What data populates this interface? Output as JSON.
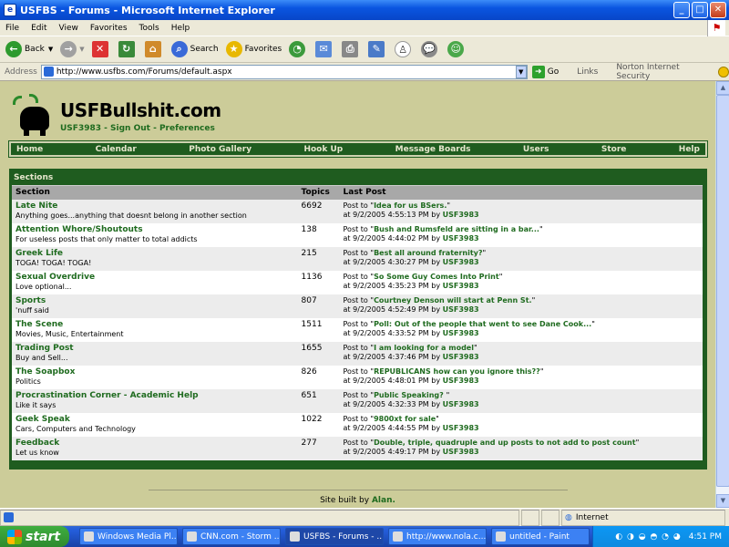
{
  "window": {
    "title": "USFBS - Forums - Microsoft Internet Explorer"
  },
  "menu": [
    "File",
    "Edit",
    "View",
    "Favorites",
    "Tools",
    "Help"
  ],
  "toolbar": {
    "back": "Back",
    "search": "Search",
    "favorites": "Favorites"
  },
  "address": {
    "label": "Address",
    "url": "http://www.usfbs.com/Forums/default.aspx",
    "go": "Go",
    "links": "Links",
    "norton": "Norton Internet Security"
  },
  "site": {
    "name": "USFBullshit.com",
    "user": "USF3983",
    "sign_out": "Sign Out",
    "preferences": "Preferences",
    "sep": " - "
  },
  "nav": [
    "Home",
    "Calendar",
    "Photo Gallery",
    "Hook Up",
    "Message Boards",
    "Users",
    "Store",
    "Help"
  ],
  "sections": {
    "title": "Sections",
    "headers": {
      "section": "Section",
      "topics": "Topics",
      "last_post": "Last Post"
    },
    "rows": [
      {
        "name": "Late Nite",
        "desc": "Anything goes...anything that doesnt belong in another section",
        "topics": "6692",
        "post": "Idea for us BSers.",
        "date": "9/2/2005 4:55:13 PM",
        "by": "USF3983"
      },
      {
        "name": "Attention Whore/Shoutouts",
        "desc": "For useless posts that only matter to total addicts",
        "topics": "138",
        "post": "Bush and Rumsfeld are sitting in a bar...",
        "date": "9/2/2005 4:44:02 PM",
        "by": "USF3983"
      },
      {
        "name": "Greek Life",
        "desc": "TOGA! TOGA! TOGA!",
        "topics": "215",
        "post": "Best all around fraternity?",
        "date": "9/2/2005 4:30:27 PM",
        "by": "USF3983"
      },
      {
        "name": "Sexual Overdrive",
        "desc": "Love optional...",
        "topics": "1136",
        "post": "So Some Guy Comes Into Print",
        "date": "9/2/2005 4:35:23 PM",
        "by": "USF3983"
      },
      {
        "name": "Sports",
        "desc": "'nuff said",
        "topics": "807",
        "post": "Courtney Denson will start at Penn St.",
        "date": "9/2/2005 4:52:49 PM",
        "by": "USF3983"
      },
      {
        "name": "The Scene",
        "desc": "Movies, Music, Entertainment",
        "topics": "1511",
        "post": "Poll: Out of the people that went to see Dane Cook...",
        "date": "9/2/2005 4:33:52 PM",
        "by": "USF3983"
      },
      {
        "name": "Trading Post",
        "desc": "Buy and Sell...",
        "topics": "1655",
        "post": "I am looking for a model",
        "date": "9/2/2005 4:37:46 PM",
        "by": "USF3983"
      },
      {
        "name": "The Soapbox",
        "desc": "Politics",
        "topics": "826",
        "post": "REPUBLICANS how can you ignore this??",
        "date": "9/2/2005 4:48:01 PM",
        "by": "USF3983"
      },
      {
        "name": "Procrastination Corner - Academic Help",
        "desc": "Like it says",
        "topics": "651",
        "post": "Public Speaking? ",
        "date": "9/2/2005 4:32:33 PM",
        "by": "USF3983"
      },
      {
        "name": "Geek Speak",
        "desc": "Cars, Computers and Technology",
        "topics": "1022",
        "post": "9800xt for sale",
        "date": "9/2/2005 4:44:55 PM",
        "by": "USF3983"
      },
      {
        "name": "Feedback",
        "desc": "Let us know",
        "topics": "277",
        "post": "Double, triple, quadruple and up posts to not add to post count",
        "date": "9/2/2005 4:49:17 PM",
        "by": "USF3983"
      }
    ]
  },
  "footer": {
    "text": "Site built by ",
    "author": "Alan."
  },
  "status": {
    "zone": "Internet"
  },
  "taskbar": {
    "start": "start",
    "tasks": [
      "Windows Media Pl...",
      "CNN.com - Storm ...",
      "USFBS - Forums - ...",
      "http://www.nola.c...",
      "untitled - Paint"
    ],
    "active_index": 2,
    "clock": "4:51 PM"
  },
  "colors": {
    "accent": "#1f5c1f",
    "page_bg": "#cccc99",
    "link": "#1f6b1f"
  }
}
